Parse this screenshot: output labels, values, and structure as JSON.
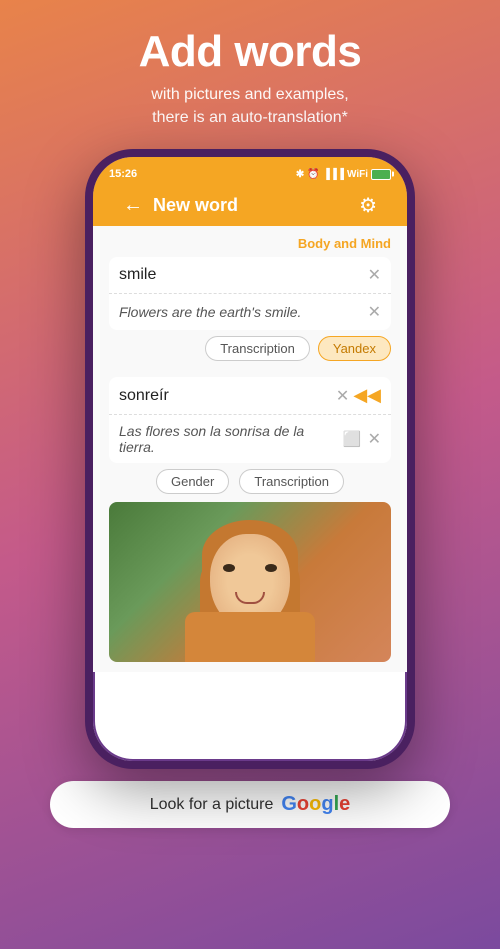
{
  "promo": {
    "title": "Add words",
    "subtitle": "with pictures and examples,\nthere is an auto-translation*"
  },
  "statusBar": {
    "time": "15:26",
    "icons": "bluetooth alarm signal wifi battery"
  },
  "navBar": {
    "backLabel": "←",
    "title": "New word",
    "settingsIcon": "⚙"
  },
  "content": {
    "categoryLabel": "Body and Mind",
    "wordField": "smile",
    "exampleField": "Flowers are the earth's smile.",
    "transcriptionButton": "Transcription",
    "yandexButton": "Yandex",
    "translationWord": "sonreír",
    "translationExample": "Las flores son la sonrisa de la tierra.",
    "genderButton": "Gender",
    "transcriptionButton2": "Transcription"
  },
  "googleBar": {
    "text": "Look for a picture",
    "googleLetters": [
      "G",
      "o",
      "o",
      "g",
      "l",
      "e"
    ]
  }
}
